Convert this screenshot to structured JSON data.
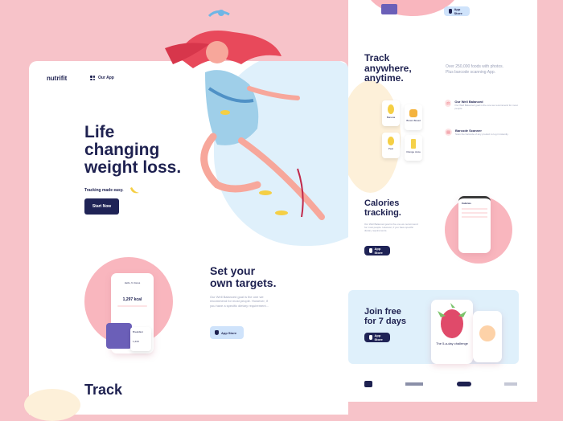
{
  "brand": {
    "logo": "nutrifit"
  },
  "nav": {
    "our_app": "Our App"
  },
  "hero": {
    "title_lines": [
      "Life",
      "changing",
      "weight loss."
    ],
    "subtitle": "Tracking made easy.",
    "cta": "Start Now"
  },
  "targets": {
    "title_lines": [
      "Set your",
      "own targets."
    ],
    "body": "Our Well Balanced goal is the one we recommend for most people. However, if you have a specific dietary requirement...",
    "store_label": "App Store",
    "phone": {
      "name": "Hello, N Jones",
      "kcal": "1,297 kcal",
      "card_label": "Breakfast",
      "card_value": "1,218"
    }
  },
  "track_bottom": {
    "title": "Track"
  },
  "right": {
    "top_store_label": "App Store",
    "track": {
      "title_lines": [
        "Track",
        "anywhere,",
        "anytime."
      ],
      "desc": "Over 250,000 foods with photos. Plus barcode scanning App.",
      "foods": [
        "Banana",
        "Brown Bread",
        "Pear",
        "Orange Juice"
      ],
      "features": [
        {
          "icon": "scale-icon",
          "title": "Our Well Balanced",
          "desc": "Our Well Balanced goal is the one we recommend for most people."
        },
        {
          "icon": "barcode-icon",
          "title": "Barcode Scanner",
          "desc": "Scan the barcode of any product to log it instantly."
        }
      ]
    },
    "calories": {
      "title_lines": [
        "Calories",
        "tracking."
      ],
      "desc": "Our Well Balanced goal is the one we recommend for most people. However, if you have specific dietary requirements.",
      "store_label": "App Store",
      "phone_header": "Calories"
    },
    "join": {
      "title_lines": [
        "Join free",
        "for 7 days"
      ],
      "store_label": "App Store",
      "card_caption": "The 5-a-day challenge"
    },
    "partners": [
      "",
      "",
      "",
      ""
    ]
  },
  "colors": {
    "background": "#f7c3c9",
    "navy": "#1f2356",
    "blue": "#dff0fb",
    "pink": "#f9b6be"
  }
}
